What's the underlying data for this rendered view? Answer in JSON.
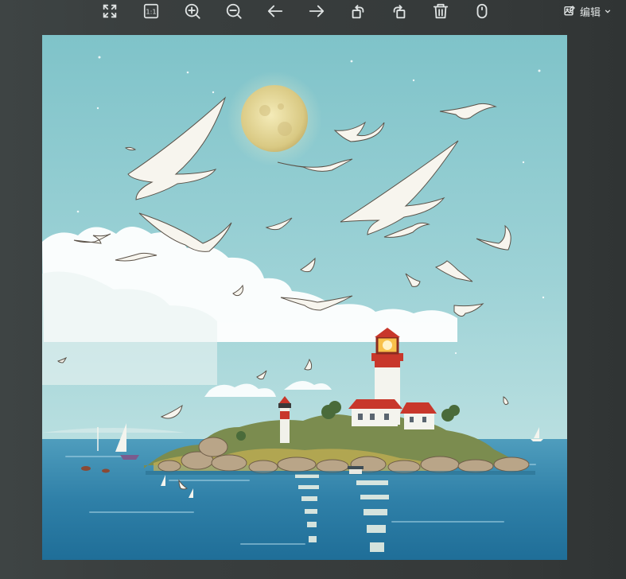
{
  "toolbar": {
    "tools": [
      {
        "name": "fullscreen-icon"
      },
      {
        "name": "actual-size-icon",
        "text": "1:1"
      },
      {
        "name": "zoom-in-icon"
      },
      {
        "name": "zoom-out-icon"
      },
      {
        "name": "arrow-left-icon"
      },
      {
        "name": "arrow-right-icon"
      },
      {
        "name": "rotate-left-icon"
      },
      {
        "name": "rotate-right-icon"
      },
      {
        "name": "trash-icon"
      },
      {
        "name": "mouse-icon"
      }
    ],
    "edit_label": "编辑",
    "icon_color": "#dfe3e3"
  },
  "image": {
    "description_icon": "seascape-lighthouse-image"
  }
}
